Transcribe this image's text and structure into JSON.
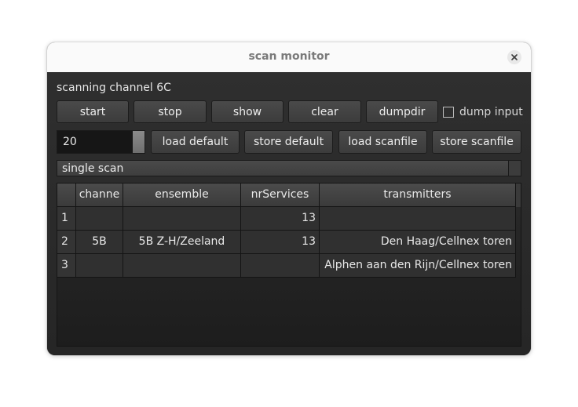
{
  "window": {
    "title": "scan monitor"
  },
  "status": {
    "text": "scanning channel 6C"
  },
  "toolbar": {
    "start": "start",
    "stop": "stop",
    "show": "show",
    "clear": "clear",
    "dumpdir": "dumpdir",
    "dump_input_label": "dump input",
    "dump_input_checked": false
  },
  "spinbox": {
    "value": "20"
  },
  "buttons": {
    "load_default": "load default",
    "store_default": "store default",
    "load_scanfile": "load scanfile",
    "store_scanfile": "store scanfile"
  },
  "mode": {
    "selected": "single scan"
  },
  "table": {
    "headers": [
      "channe",
      "ensemble",
      "nrServices",
      "transmitters"
    ],
    "rows": [
      {
        "index": "1",
        "channel": "",
        "ensemble": "",
        "nrServices": "13",
        "transmitters": ""
      },
      {
        "index": "2",
        "channel": "5B",
        "ensemble": "5B Z-H/Zeeland",
        "nrServices": "13",
        "transmitters": "Den Haag/Cellnex toren"
      },
      {
        "index": "3",
        "channel": "",
        "ensemble": "",
        "nrServices": "",
        "transmitters": "Alphen aan den Rijn/Cellnex toren"
      }
    ]
  },
  "icons": {
    "close": "close-icon",
    "dropdown": "chevron-down-icon"
  }
}
